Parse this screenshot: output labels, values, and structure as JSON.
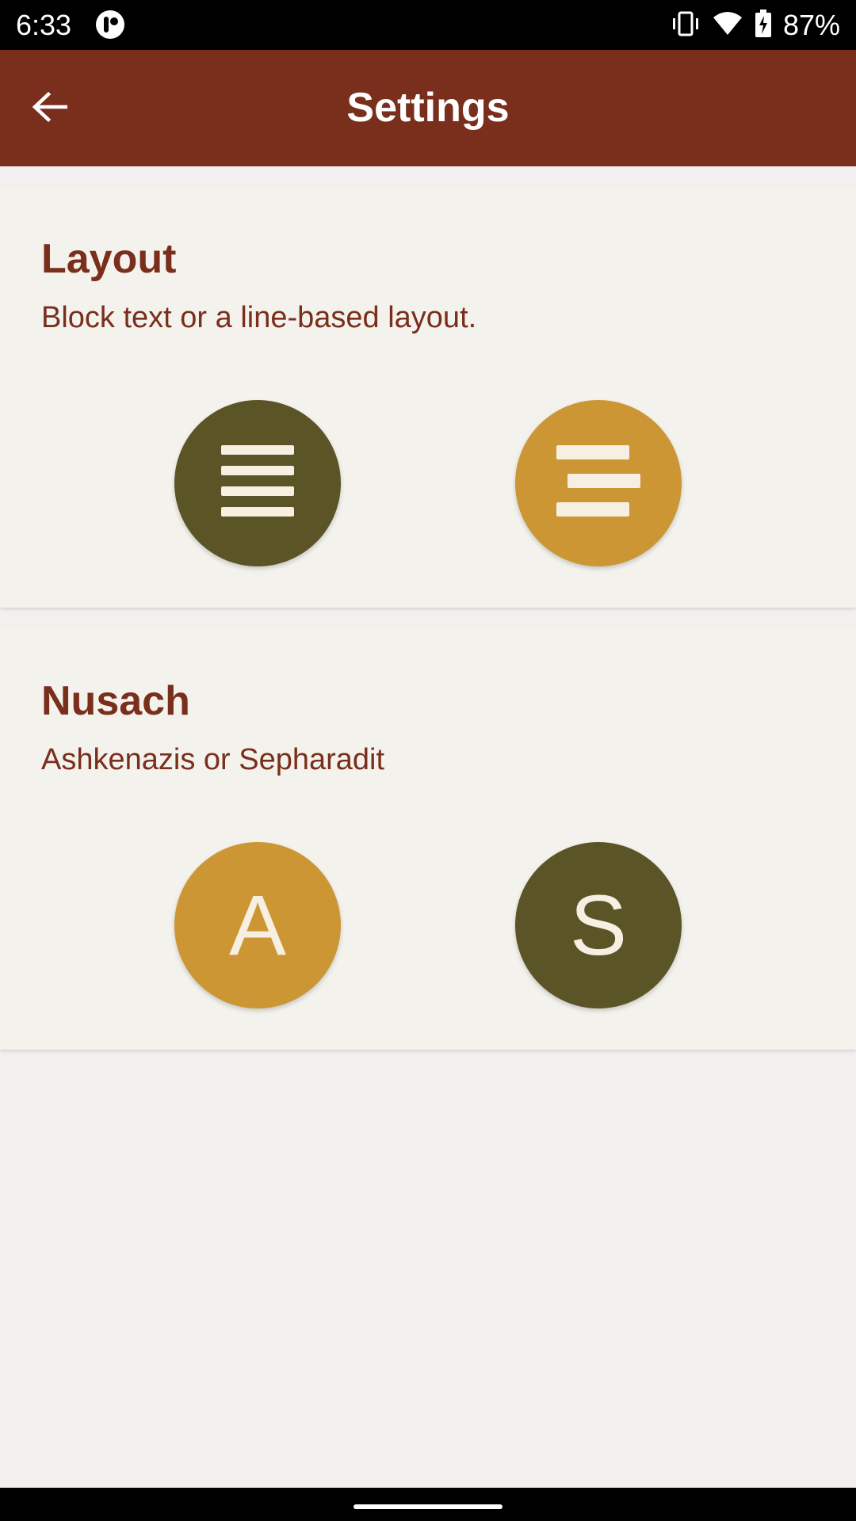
{
  "status_bar": {
    "time": "6:33",
    "battery": "87%"
  },
  "app_bar": {
    "title": "Settings",
    "back_icon": "arrow-left-icon"
  },
  "layout_section": {
    "title": "Layout",
    "subtitle": "Block text or a line-based layout.",
    "options": [
      {
        "name": "block-text",
        "icon": "justify-lines-icon",
        "selected": true
      },
      {
        "name": "line-based",
        "icon": "centered-lines-icon",
        "selected": false
      }
    ]
  },
  "nusach_section": {
    "title": "Nusach",
    "subtitle": "Ashkenazis or Sepharadit",
    "options": [
      {
        "letter": "A",
        "selected": false
      },
      {
        "letter": "S",
        "selected": true
      }
    ]
  },
  "colors": {
    "primary": "#7a2e1c",
    "selected": "#5b5426",
    "unselected": "#cc9634",
    "card": "#f4f2ec"
  }
}
